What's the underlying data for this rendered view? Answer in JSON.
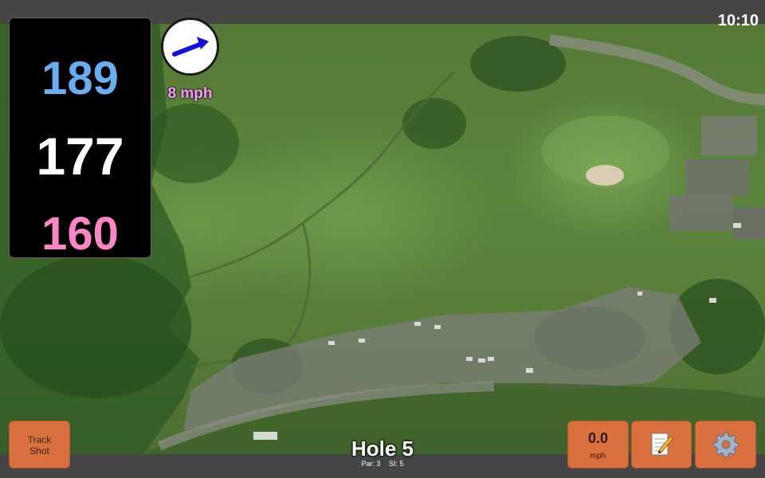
{
  "status_bar": {
    "time": "10:10"
  },
  "yardages": {
    "back": "189",
    "center": "177",
    "front": "160"
  },
  "wind": {
    "speed": "8 mph",
    "direction_icon": "wind-arrow-icon"
  },
  "hole": {
    "title": "Hole 5",
    "par": "Par: 3",
    "stroke_index": "SI: 5"
  },
  "buttons": {
    "track_shot_line1": "Track",
    "track_shot_line2": "Shot",
    "shot_speed_value": "0.0",
    "shot_speed_unit": "mph",
    "notes_icon": "notepad-icon",
    "settings_icon": "gear-icon"
  },
  "colors": {
    "back_yardage": "#6aaef2",
    "center_yardage": "#ffffff",
    "front_yardage": "#ff86c6",
    "button_accent": "#d9703e",
    "wind_text": "#ff9aff"
  }
}
